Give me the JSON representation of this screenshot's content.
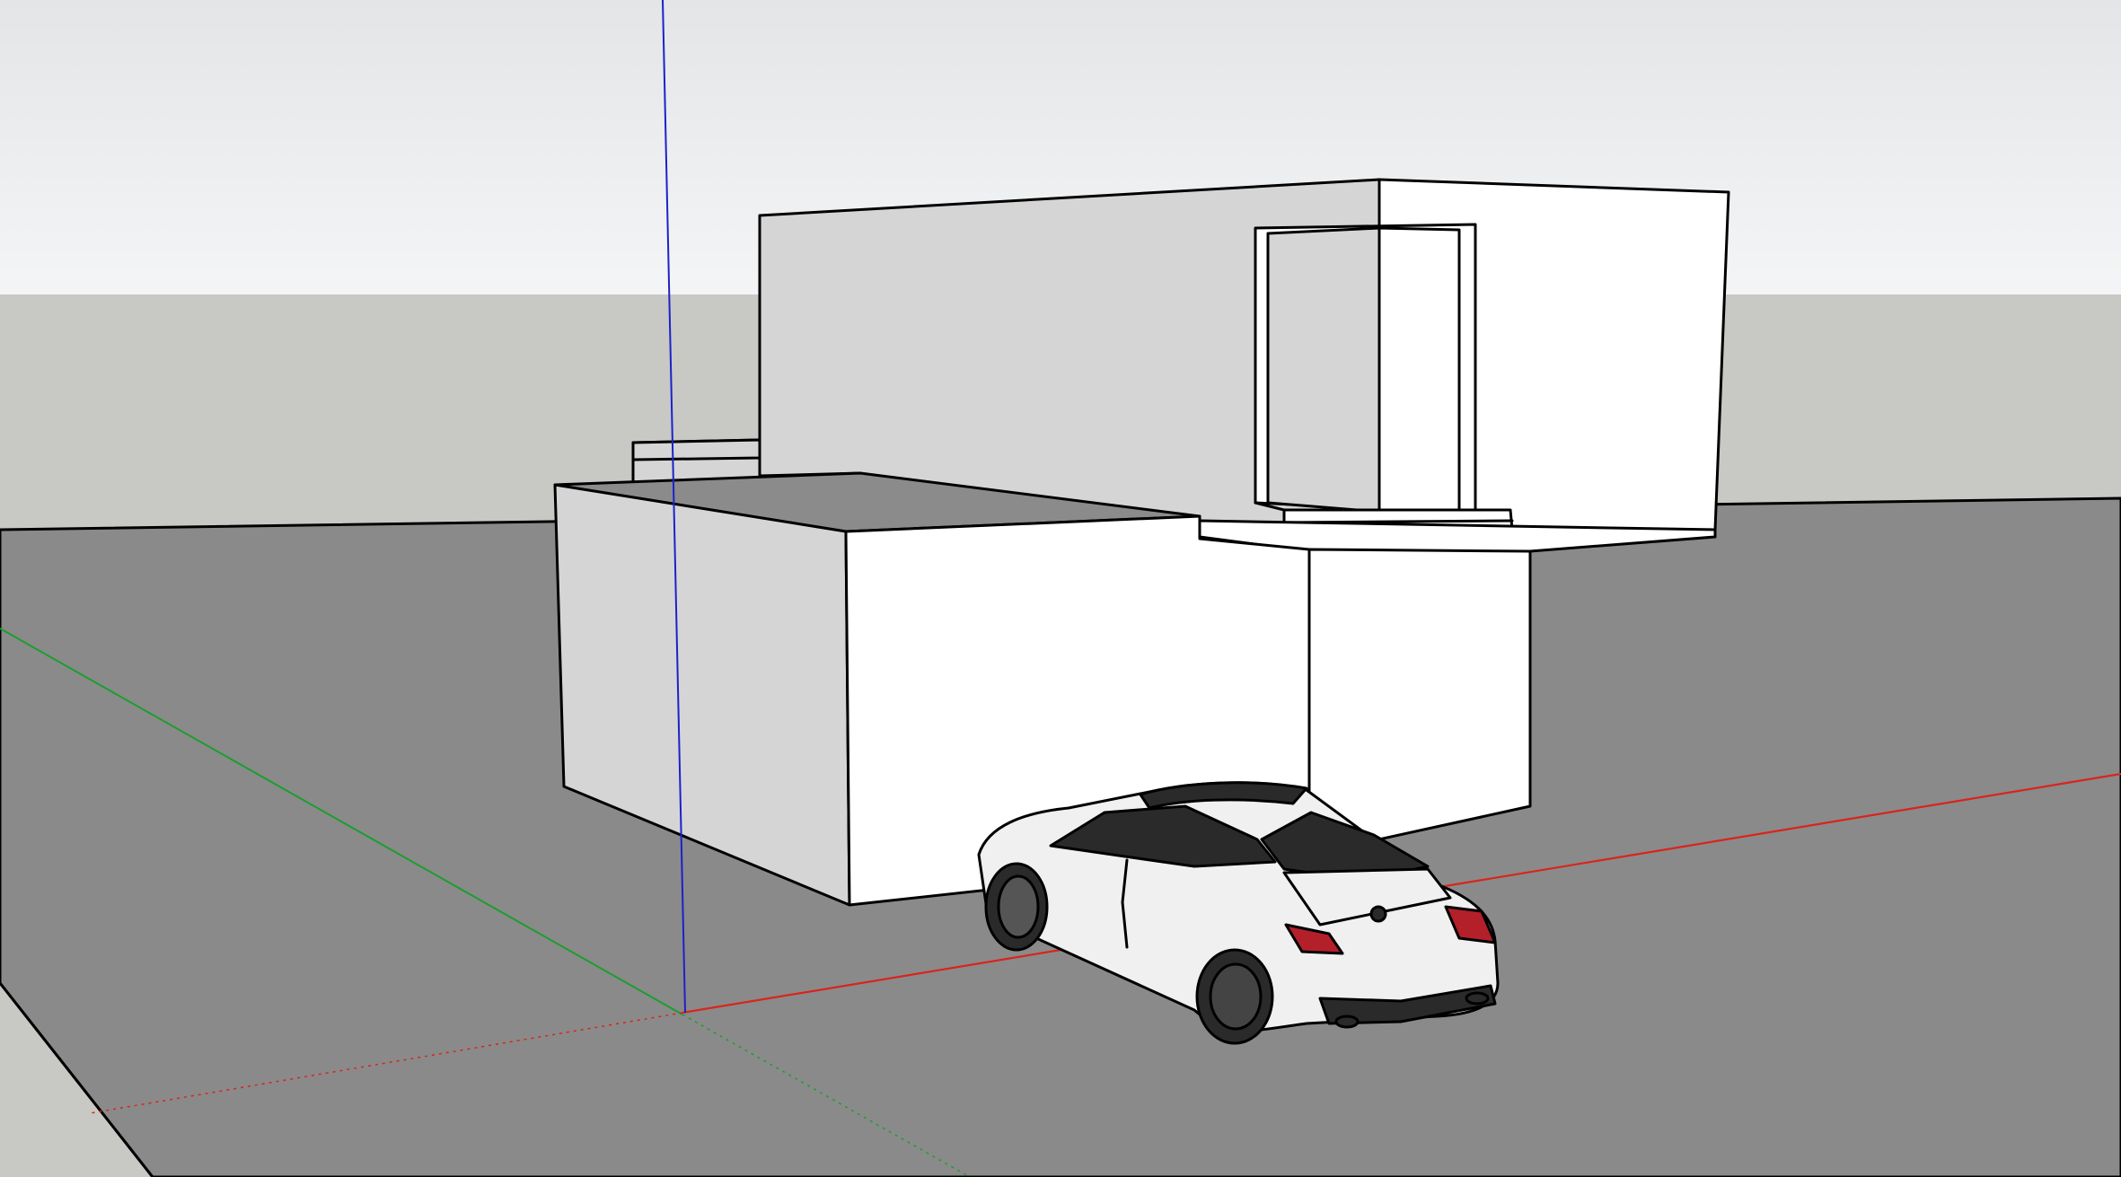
{
  "app": {
    "title": "",
    "kind": "3D modeling viewport"
  },
  "scene": {
    "objects": [
      {
        "name": "ground-plane",
        "visible": true
      },
      {
        "name": "two-storey-building",
        "visible": true
      },
      {
        "name": "window-opening",
        "visible": true
      },
      {
        "name": "parked-car",
        "visible": true
      }
    ],
    "axes": [
      {
        "name": "red-axis",
        "color": "#d9241c"
      },
      {
        "name": "green-axis",
        "color": "#1b9e2e"
      },
      {
        "name": "blue-axis",
        "color": "#1c22c9"
      }
    ]
  },
  "colors": {
    "sky_top": "#e3e5e7",
    "sky_bottom": "#f4f5f6",
    "ground_far": "#c8c8c5",
    "ground_surface": "#8a8a8a",
    "wall_shaded": "#d5d5d5",
    "wall_lit": "#ffffff",
    "roof_top": "#8b8b8b",
    "edge": "#000000",
    "car_body": "#f0f0f0",
    "car_glass": "#2a2a2a",
    "car_light": "#b3202a"
  }
}
